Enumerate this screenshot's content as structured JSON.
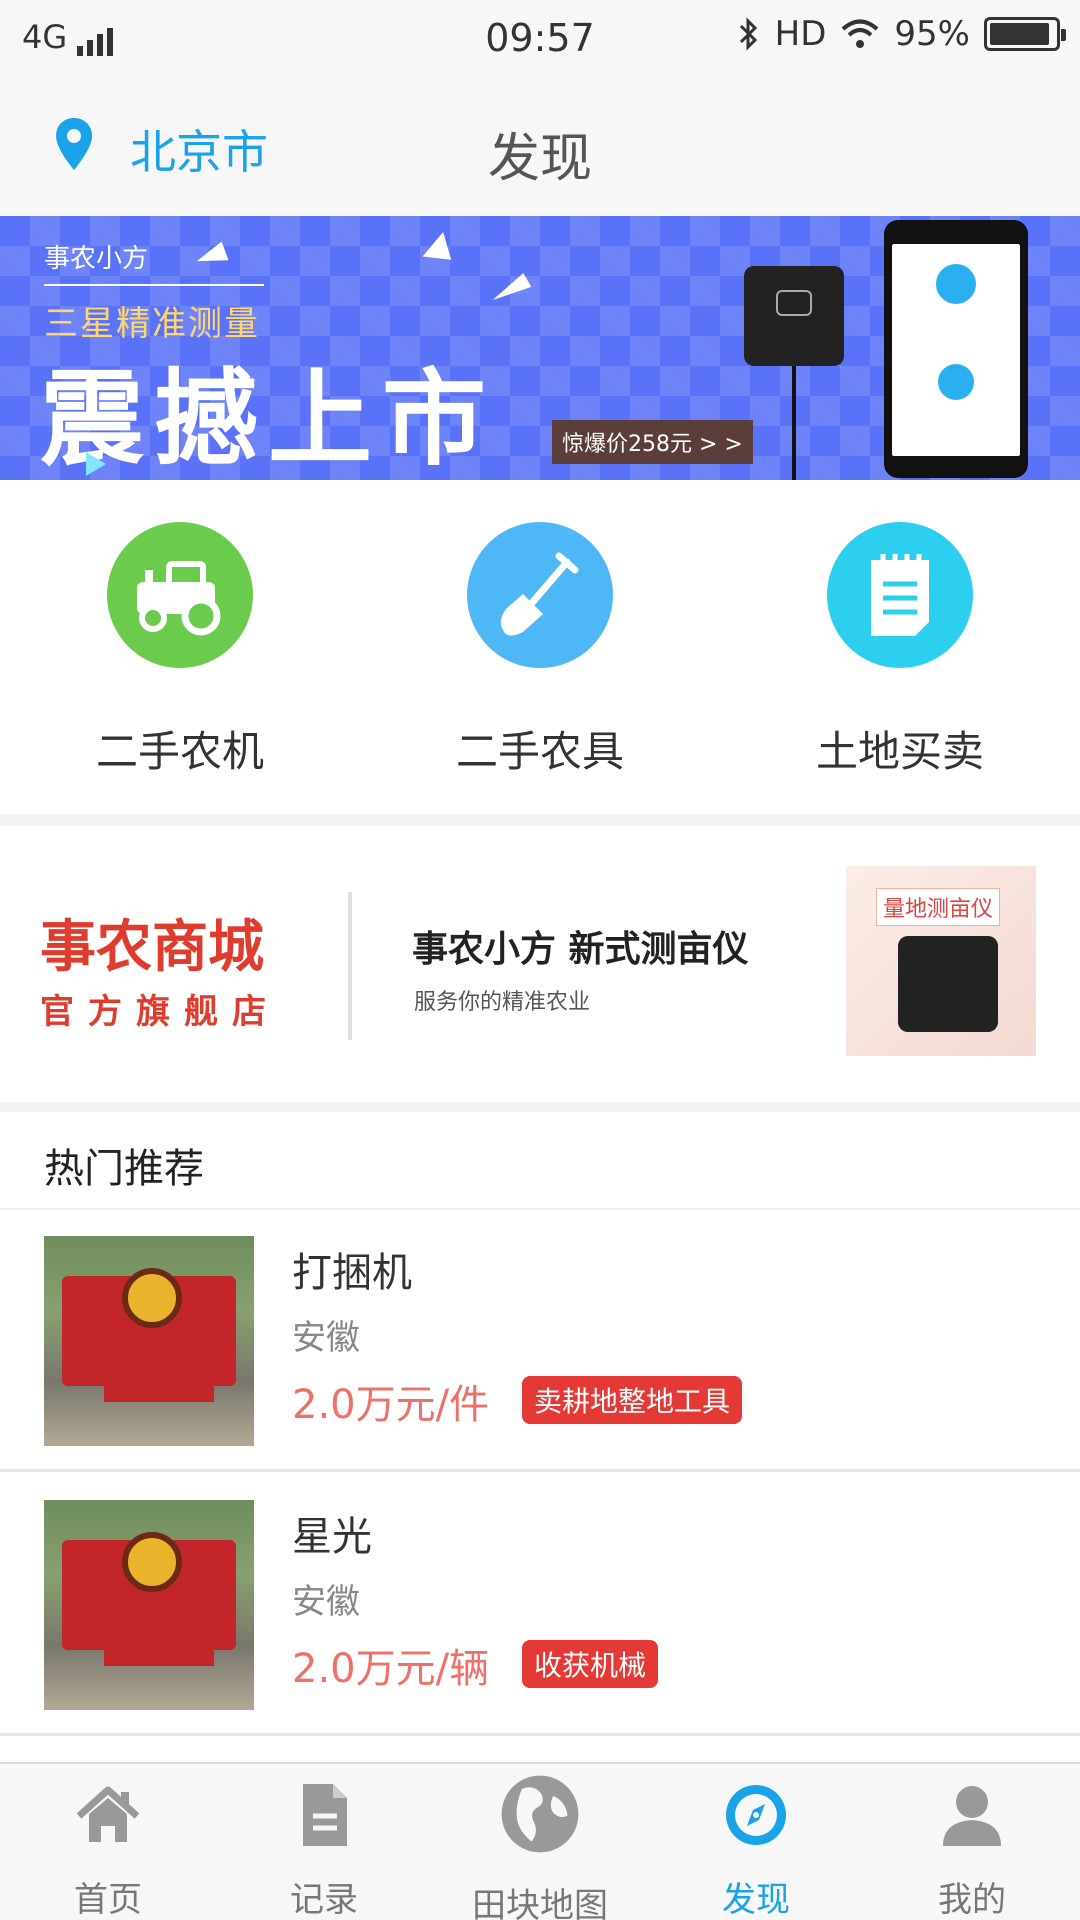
{
  "status_bar": {
    "network": "4G",
    "time": "09:57",
    "hd": "HD",
    "battery": "95%"
  },
  "header": {
    "city": "北京市",
    "title": "发现"
  },
  "banner": {
    "brand": "事农小方",
    "subtitle": "三星精准测量",
    "headline": "震撼上市",
    "price_tag": "惊爆价258元 > >"
  },
  "categories": [
    {
      "label": "二手农机",
      "icon": "tractor-icon",
      "color": "#6acb4c"
    },
    {
      "label": "二手农具",
      "icon": "shovel-icon",
      "color": "#4db8f5"
    },
    {
      "label": "土地买卖",
      "icon": "notepad-icon",
      "color": "#2ccfee"
    }
  ],
  "mall": {
    "name": "事农商城",
    "tag": "官方旗舰店",
    "product_title": "事农小方  新式测亩仪",
    "product_desc": "服务你的精准农业",
    "image_caption": "量地测亩仪"
  },
  "hot": {
    "title": "热门推荐",
    "items": [
      {
        "name": "打捆机",
        "region": "安徽",
        "price": "2.0万元/件",
        "badge": "卖耕地整地工具"
      },
      {
        "name": "星光",
        "region": "安徽",
        "price": "2.0万元/辆",
        "badge": "收获机械"
      }
    ]
  },
  "tabbar": {
    "active": "发现",
    "tabs": [
      {
        "label": "首页",
        "icon": "home-icon"
      },
      {
        "label": "记录",
        "icon": "document-icon"
      },
      {
        "label": "田块地图",
        "icon": "globe-icon"
      },
      {
        "label": "发现",
        "icon": "compass-icon"
      },
      {
        "label": "我的",
        "icon": "user-icon"
      }
    ]
  },
  "colors": {
    "accent": "#1aa3e8",
    "price": "#f07068",
    "badge": "#e53935",
    "mall_red": "#e03c2e"
  }
}
